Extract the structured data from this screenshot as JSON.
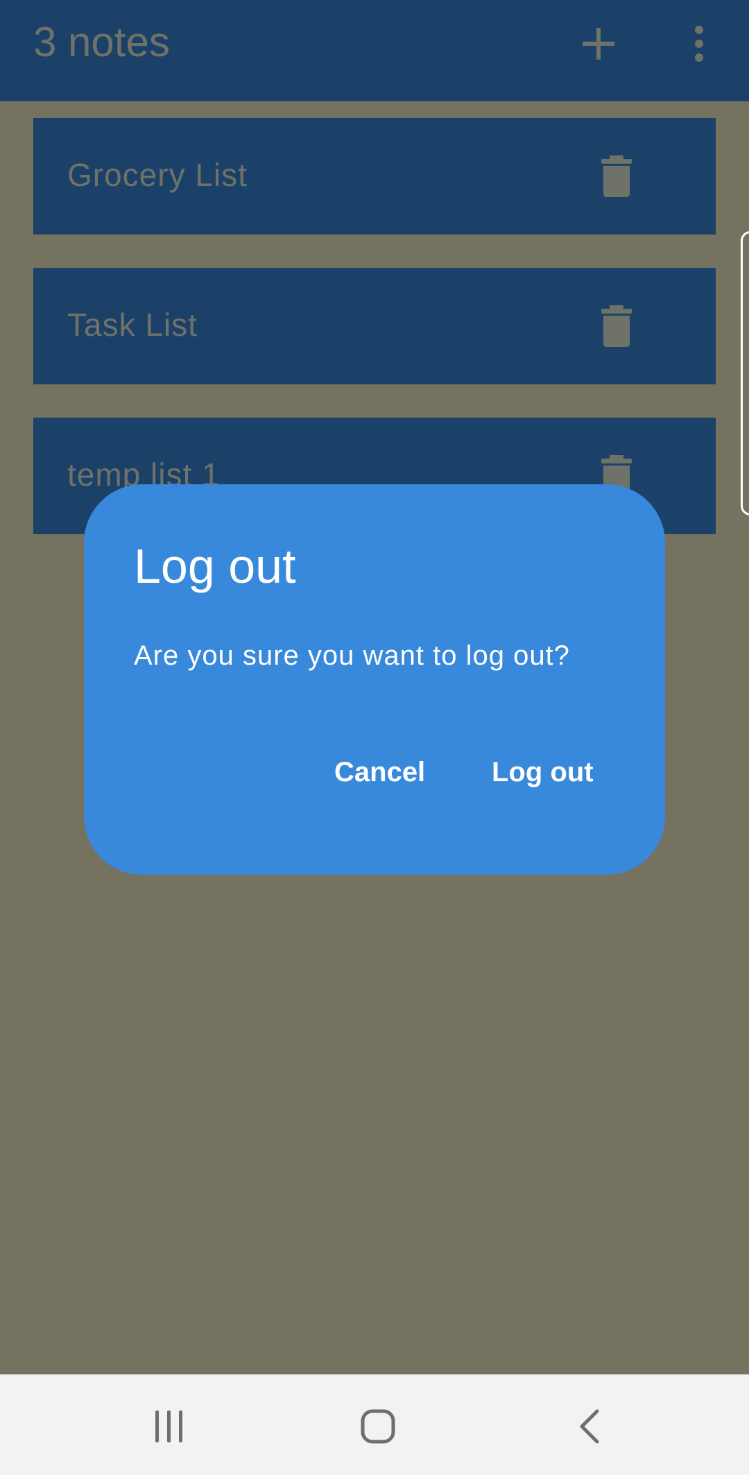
{
  "app_bar": {
    "title": "3 notes",
    "icons": [
      "plus-icon",
      "more-vert-icon"
    ]
  },
  "notes": [
    {
      "title": "Grocery List"
    },
    {
      "title": "Task List"
    },
    {
      "title": "temp list 1"
    }
  ],
  "dialog": {
    "title": "Log out",
    "message": "Are you sure you want to log out?",
    "cancel_label": "Cancel",
    "confirm_label": "Log out"
  },
  "nav_bar": {
    "icons": [
      "recent-apps-icon",
      "home-icon",
      "back-icon"
    ]
  },
  "colors": {
    "scrim_background": "#75725f",
    "app_bar": "#1c4169",
    "note_card": "#1c4169",
    "dialog": "#3888db",
    "dialog_text": "#ffffff",
    "nav_bar": "#f2f2f2"
  }
}
